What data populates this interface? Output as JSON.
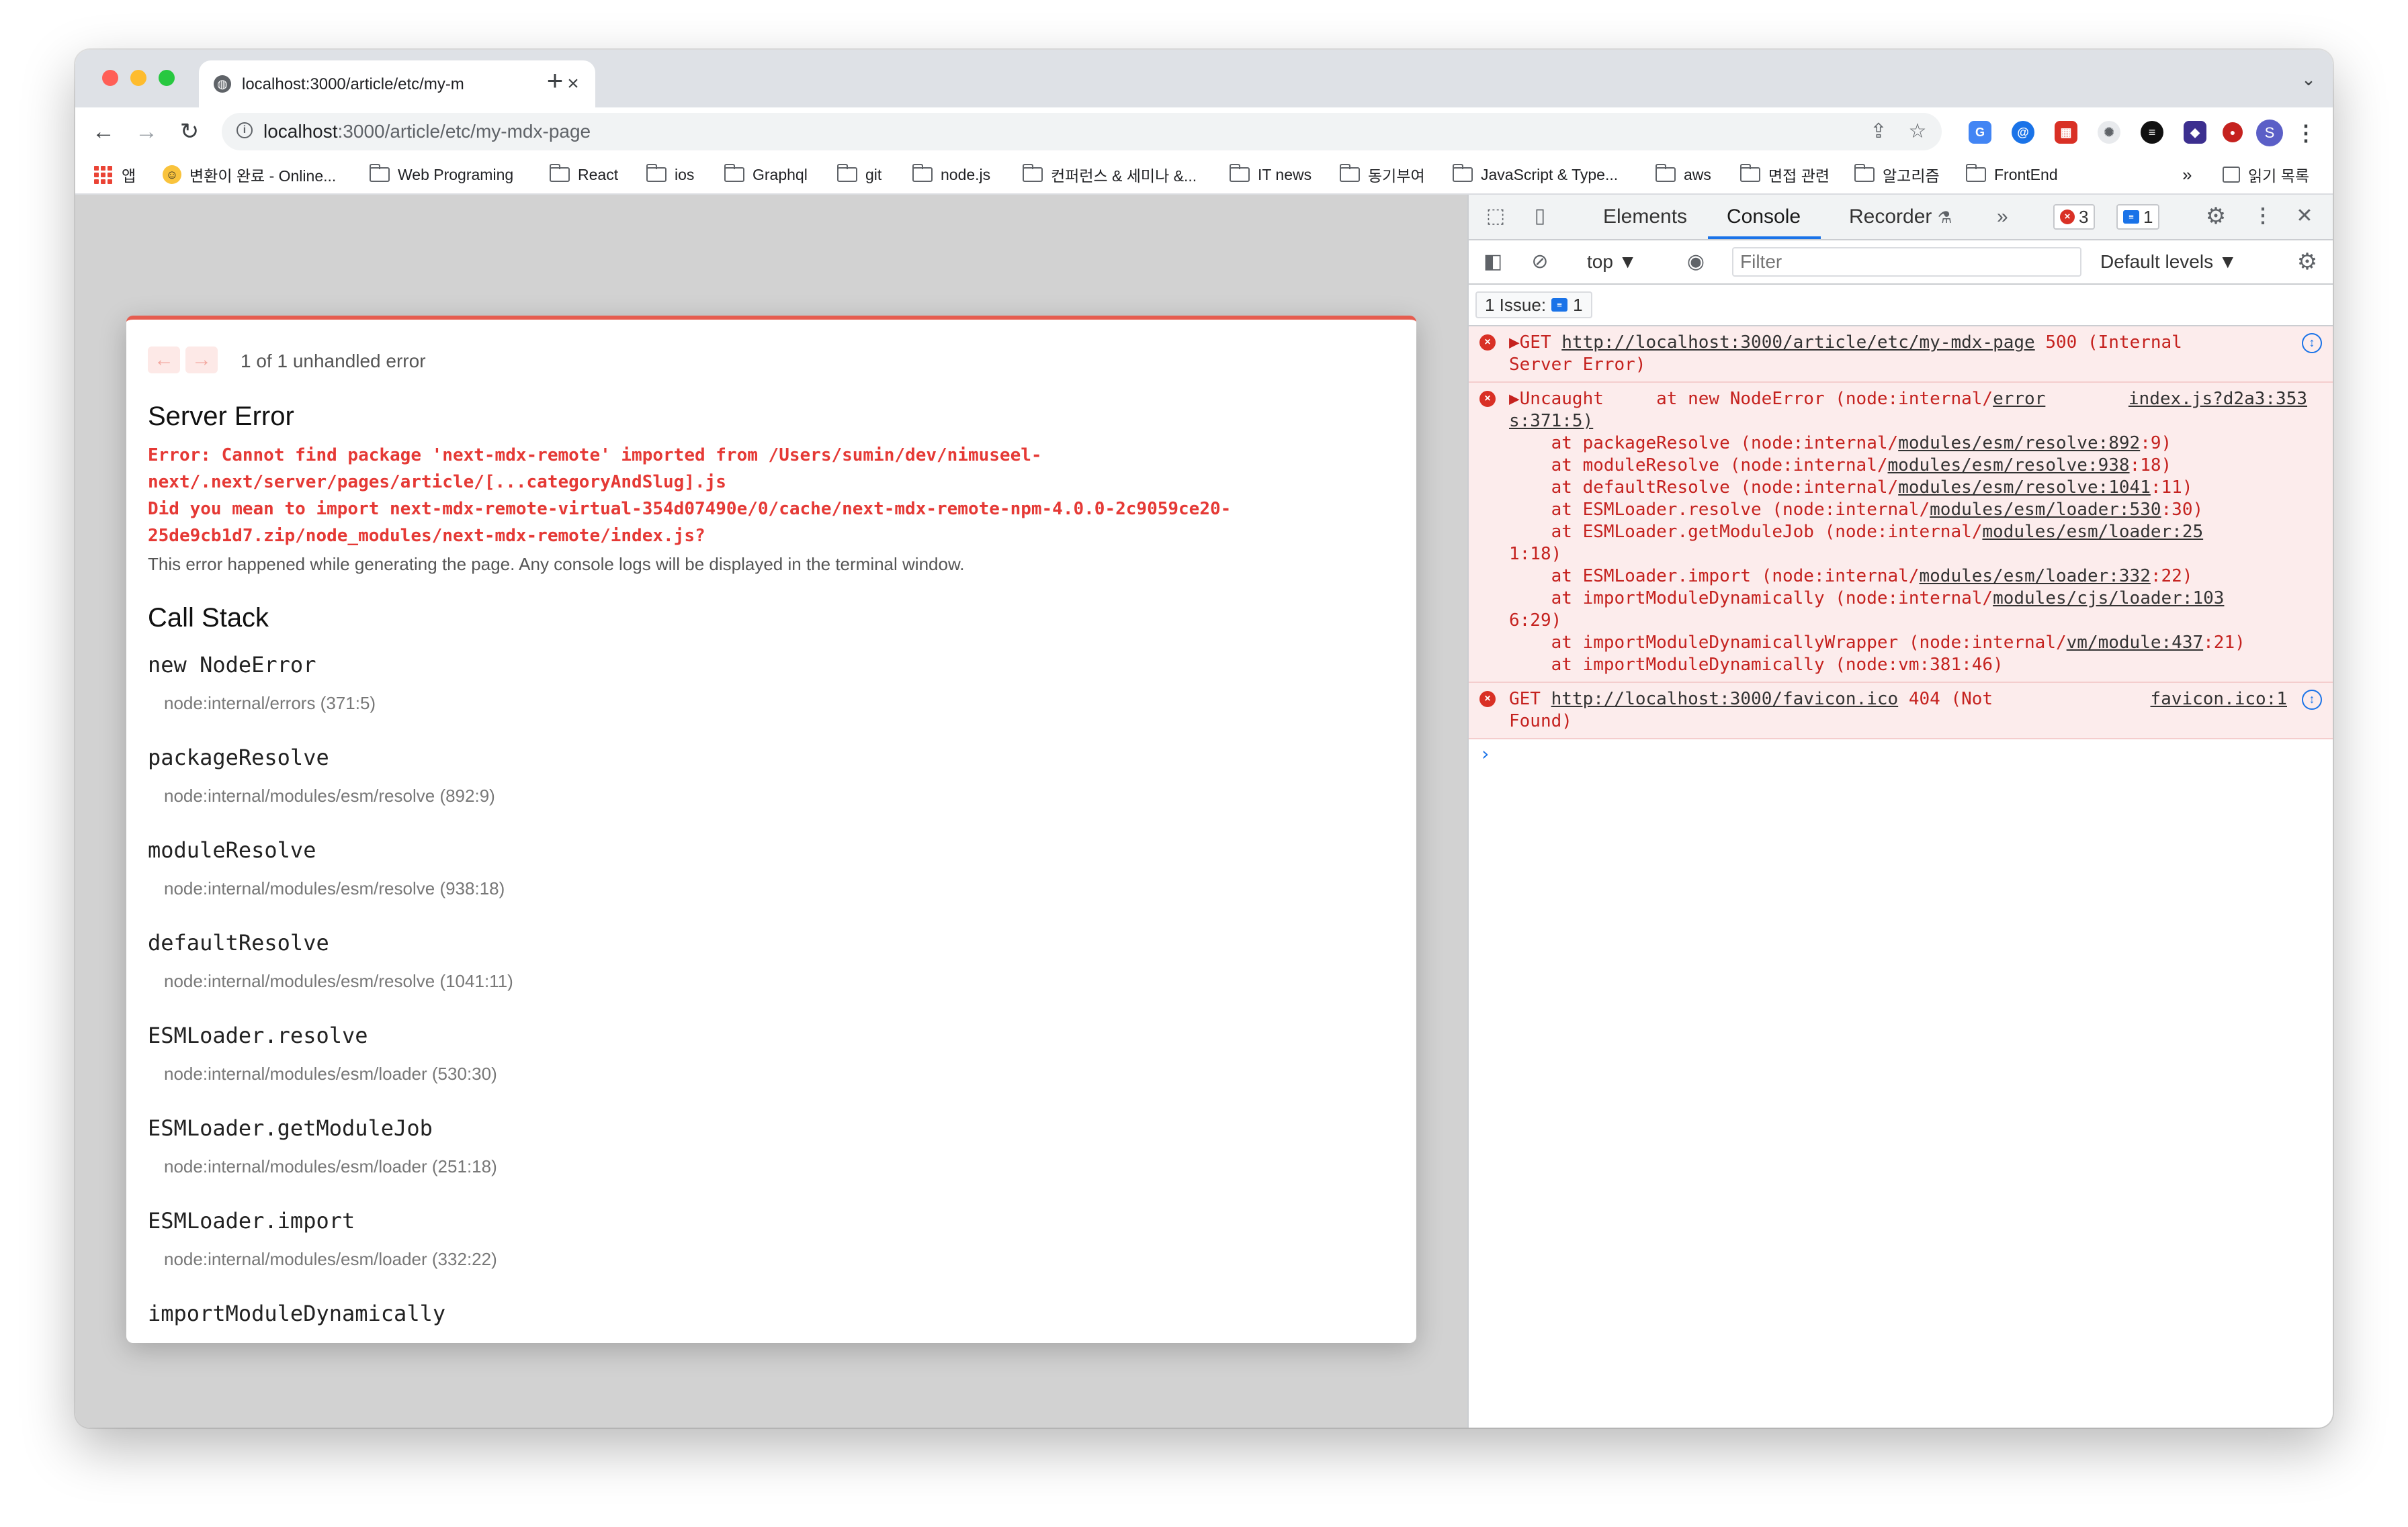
{
  "tab": {
    "title": "localhost:3000/article/etc/my-m",
    "close": "×",
    "new_tab": "+"
  },
  "toolbar": {
    "back": "←",
    "forward": "→",
    "reload": "↻",
    "url_host": "localhost",
    "url_path": ":3000/article/etc/my-mdx-page",
    "profile_initial": "S"
  },
  "bookmarks": {
    "apps": "앱",
    "items": [
      "변환이 완료 - Online...",
      "Web Programing",
      "React",
      "ios",
      "Graphql",
      "git",
      "node.js",
      "컨퍼런스 & 세미나 &...",
      "IT news",
      "동기부여",
      "JavaScript & Type...",
      "aws",
      "면접 관련",
      "알고리즘",
      "FrontEnd"
    ],
    "more": "»",
    "reading_list": "읽기 목록"
  },
  "error_overlay": {
    "count_text": "1 of 1 unhandled error",
    "title": "Server Error",
    "message": "Error: Cannot find package 'next-mdx-remote' imported from /Users/sumin/dev/nimuseel-\nnext/.next/server/pages/article/[...categoryAndSlug].js\nDid you mean to import next-mdx-remote-virtual-354d07490e/0/cache/next-mdx-remote-npm-4.0.0-2c9059ce20-\n25de9cb1d7.zip/node_modules/next-mdx-remote/index.js?",
    "note": "This error happened while generating the page. Any console logs will be displayed in the terminal window.",
    "call_stack_title": "Call Stack",
    "frames": [
      {
        "fn": "new NodeError",
        "loc": "node:internal/errors (371:5)"
      },
      {
        "fn": "packageResolve",
        "loc": "node:internal/modules/esm/resolve (892:9)"
      },
      {
        "fn": "moduleResolve",
        "loc": "node:internal/modules/esm/resolve (938:18)"
      },
      {
        "fn": "defaultResolve",
        "loc": "node:internal/modules/esm/resolve (1041:11)"
      },
      {
        "fn": "ESMLoader.resolve",
        "loc": "node:internal/modules/esm/loader (530:30)"
      },
      {
        "fn": "ESMLoader.getModuleJob",
        "loc": "node:internal/modules/esm/loader (251:18)"
      },
      {
        "fn": "ESMLoader.import",
        "loc": "node:internal/modules/esm/loader (332:22)"
      },
      {
        "fn": "importModuleDynamically",
        "loc": ""
      }
    ]
  },
  "devtools": {
    "tabs": {
      "elements": "Elements",
      "console": "Console",
      "recorder": "Recorder"
    },
    "more_tabs": "»",
    "error_count": "3",
    "message_count": "1",
    "context": "top ▼",
    "filter_placeholder": "Filter",
    "levels": "Default levels ▼",
    "issues_label": "1 Issue:",
    "issues_count": "1",
    "messages": [
      {
        "lines": [
          "▶GET ",
          "http://localhost:3000/article/etc/my-mdx-page",
          " 500 (Internal",
          "Server Error)"
        ]
      },
      {
        "head": "▶Uncaught     at new NodeError (node:internal/",
        "head_link": "error",
        "source": "index.js?d2a3:353",
        "source_cont": "s:371:5)",
        "stack": [
          [
            "    at packageResolve (node:internal/",
            "modules/esm/resolve:892",
            ":9)"
          ],
          [
            "    at moduleResolve (node:internal/",
            "modules/esm/resolve:938",
            ":18)"
          ],
          [
            "    at defaultResolve (node:internal/",
            "modules/esm/resolve:1041",
            ":11)"
          ],
          [
            "    at ESMLoader.resolve (node:internal/",
            "modules/esm/loader:530",
            ":30)"
          ],
          [
            "    at ESMLoader.getModuleJob (node:internal/",
            "modules/esm/loader:25",
            ""
          ],
          [
            "1:18)",
            "",
            ""
          ],
          [
            "    at ESMLoader.import (node:internal/",
            "modules/esm/loader:332",
            ":22)"
          ],
          [
            "    at importModuleDynamically (node:internal/",
            "modules/cjs/loader:103",
            ""
          ],
          [
            "6:29)",
            "",
            ""
          ],
          [
            "    at importModuleDynamicallyWrapper (node:internal/",
            "vm/module:437",
            ":21)"
          ],
          [
            "    at importModuleDynamically (node:vm:381:46)",
            "",
            ""
          ]
        ]
      },
      {
        "prefix": "GET ",
        "link": "http://localhost:3000/favicon.ico",
        "suffix": " 404 (Not",
        "cont": "Found)",
        "source": "favicon.ico:1"
      }
    ],
    "prompt": "›"
  },
  "colors": {
    "accent": "#1a73e8",
    "error": "#e53935",
    "overlay_bar": "#e55c4f"
  }
}
